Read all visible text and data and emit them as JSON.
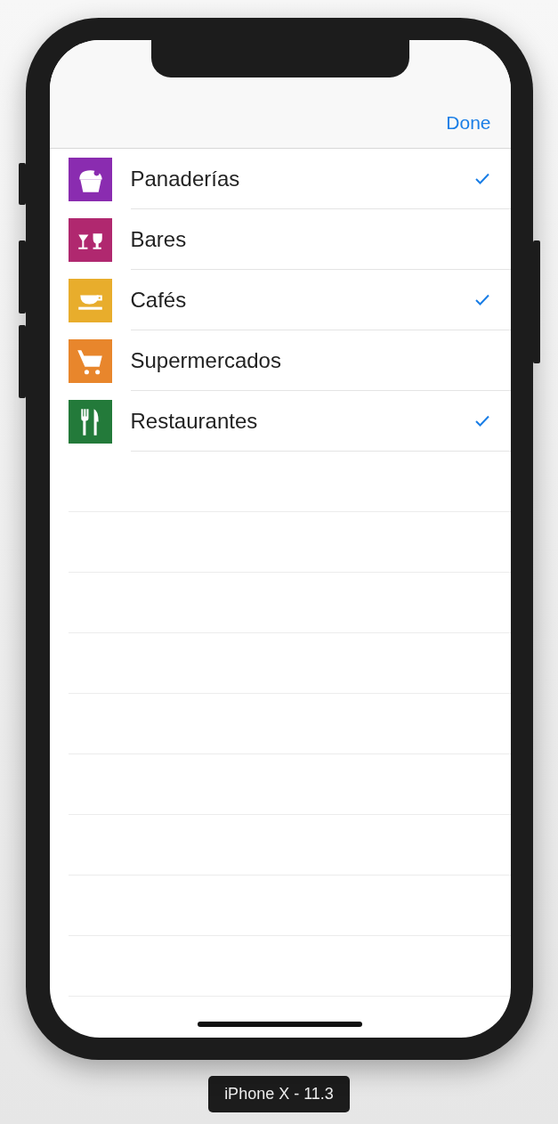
{
  "nav_bar": {
    "done_button": "Done"
  },
  "categories": [
    {
      "name": "Panaderías",
      "kind": "cupcake",
      "color": "#8a2cb0",
      "checked": true
    },
    {
      "name": "Bares",
      "kind": "glasses",
      "color": "#b0286f",
      "checked": false
    },
    {
      "name": "Cafés",
      "kind": "cup",
      "color": "#e8ad2c",
      "checked": true
    },
    {
      "name": "Supermercados",
      "kind": "cart",
      "color": "#e8862c",
      "checked": false
    },
    {
      "name": "Restaurantes",
      "kind": "cutlery",
      "color": "#237a3a",
      "checked": true
    }
  ],
  "device_label": "iPhone X - 11.3"
}
